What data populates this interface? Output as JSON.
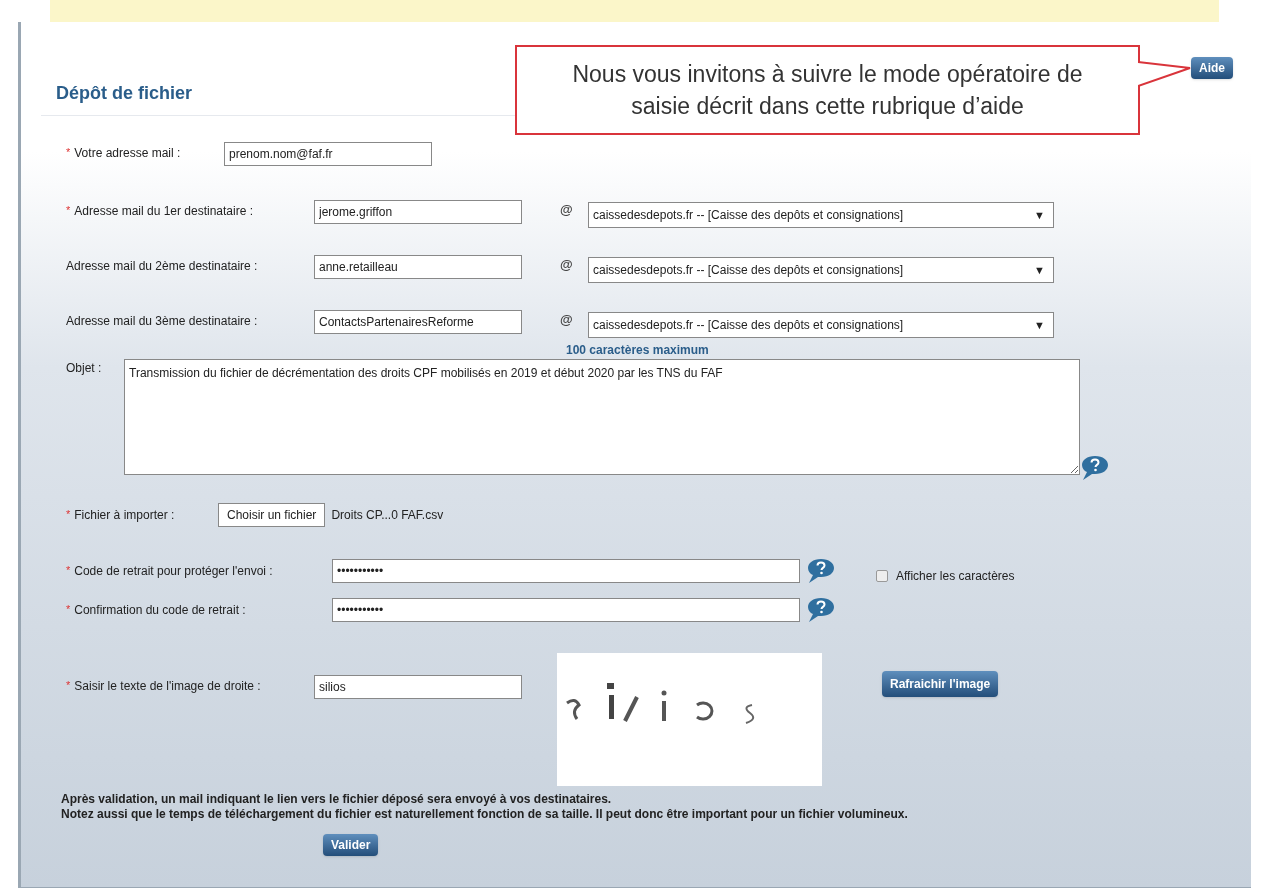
{
  "page_title": "Dépôt de fichier",
  "callout": {
    "text": "Nous vous invitons à suivre le mode opératoire de saisie décrit dans cette rubrique d’aide"
  },
  "help_button": "Aide",
  "sender": {
    "required_mark": "*",
    "label": "Votre adresse mail :",
    "value": "prenom.nom@faf.fr"
  },
  "recipients": [
    {
      "required_mark": "*",
      "label": "Adresse mail du 1er destinataire :",
      "value": "jerome.griffon",
      "at_sign": "@",
      "domain": "caissedesdepots.fr -- [Caisse des depôts et consignations]",
      "arrow": "▼"
    },
    {
      "label": "Adresse mail du 2ème destinataire :",
      "value": "anne.retailleau",
      "at_sign": "@",
      "domain": "caissedesdepots.fr -- [Caisse des depôts et consignations]",
      "arrow": "▼"
    },
    {
      "label": "Adresse mail du 3ème destinataire :",
      "value": "ContactsPartenairesReforme",
      "at_sign": "@",
      "domain": "caissedesdepots.fr -- [Caisse des depôts et consignations]",
      "arrow": "▼"
    }
  ],
  "subject": {
    "limit_note": "100 caractères maximum",
    "label": "Objet :",
    "value": "Transmission du fichier de décrémentation des droits CPF mobilisés en 2019 et début 2020 par les TNS du FAF"
  },
  "file": {
    "required_mark": "*",
    "label": "Fichier à importer :",
    "button": "Choisir un fichier",
    "file_name": "Droits CP...0 FAF.csv"
  },
  "code": {
    "required_mark": "*",
    "label": "Code de retrait pour protéger l'envoi :",
    "value": "•••••••••••"
  },
  "show_characters": {
    "label": "Afficher les caractères",
    "checked": false
  },
  "confirm": {
    "required_mark": "*",
    "label": "Confirmation du code de retrait :",
    "value": "•••••••••••"
  },
  "captcha": {
    "required_mark": "*",
    "label": "Saisir le texte de l'image de droite :",
    "value": "silios",
    "refresh_button": "Rafraichir l'image"
  },
  "notes": [
    "Après validation, un mail indiquant le lien vers le fichier déposé sera envoyé à vos destinataires.",
    "Notez aussi que le temps de téléchargement du fichier est naturellement fonction de sa taille. Il peut donc être important pour un fichier volumineux."
  ],
  "submit_button": "Valider"
}
